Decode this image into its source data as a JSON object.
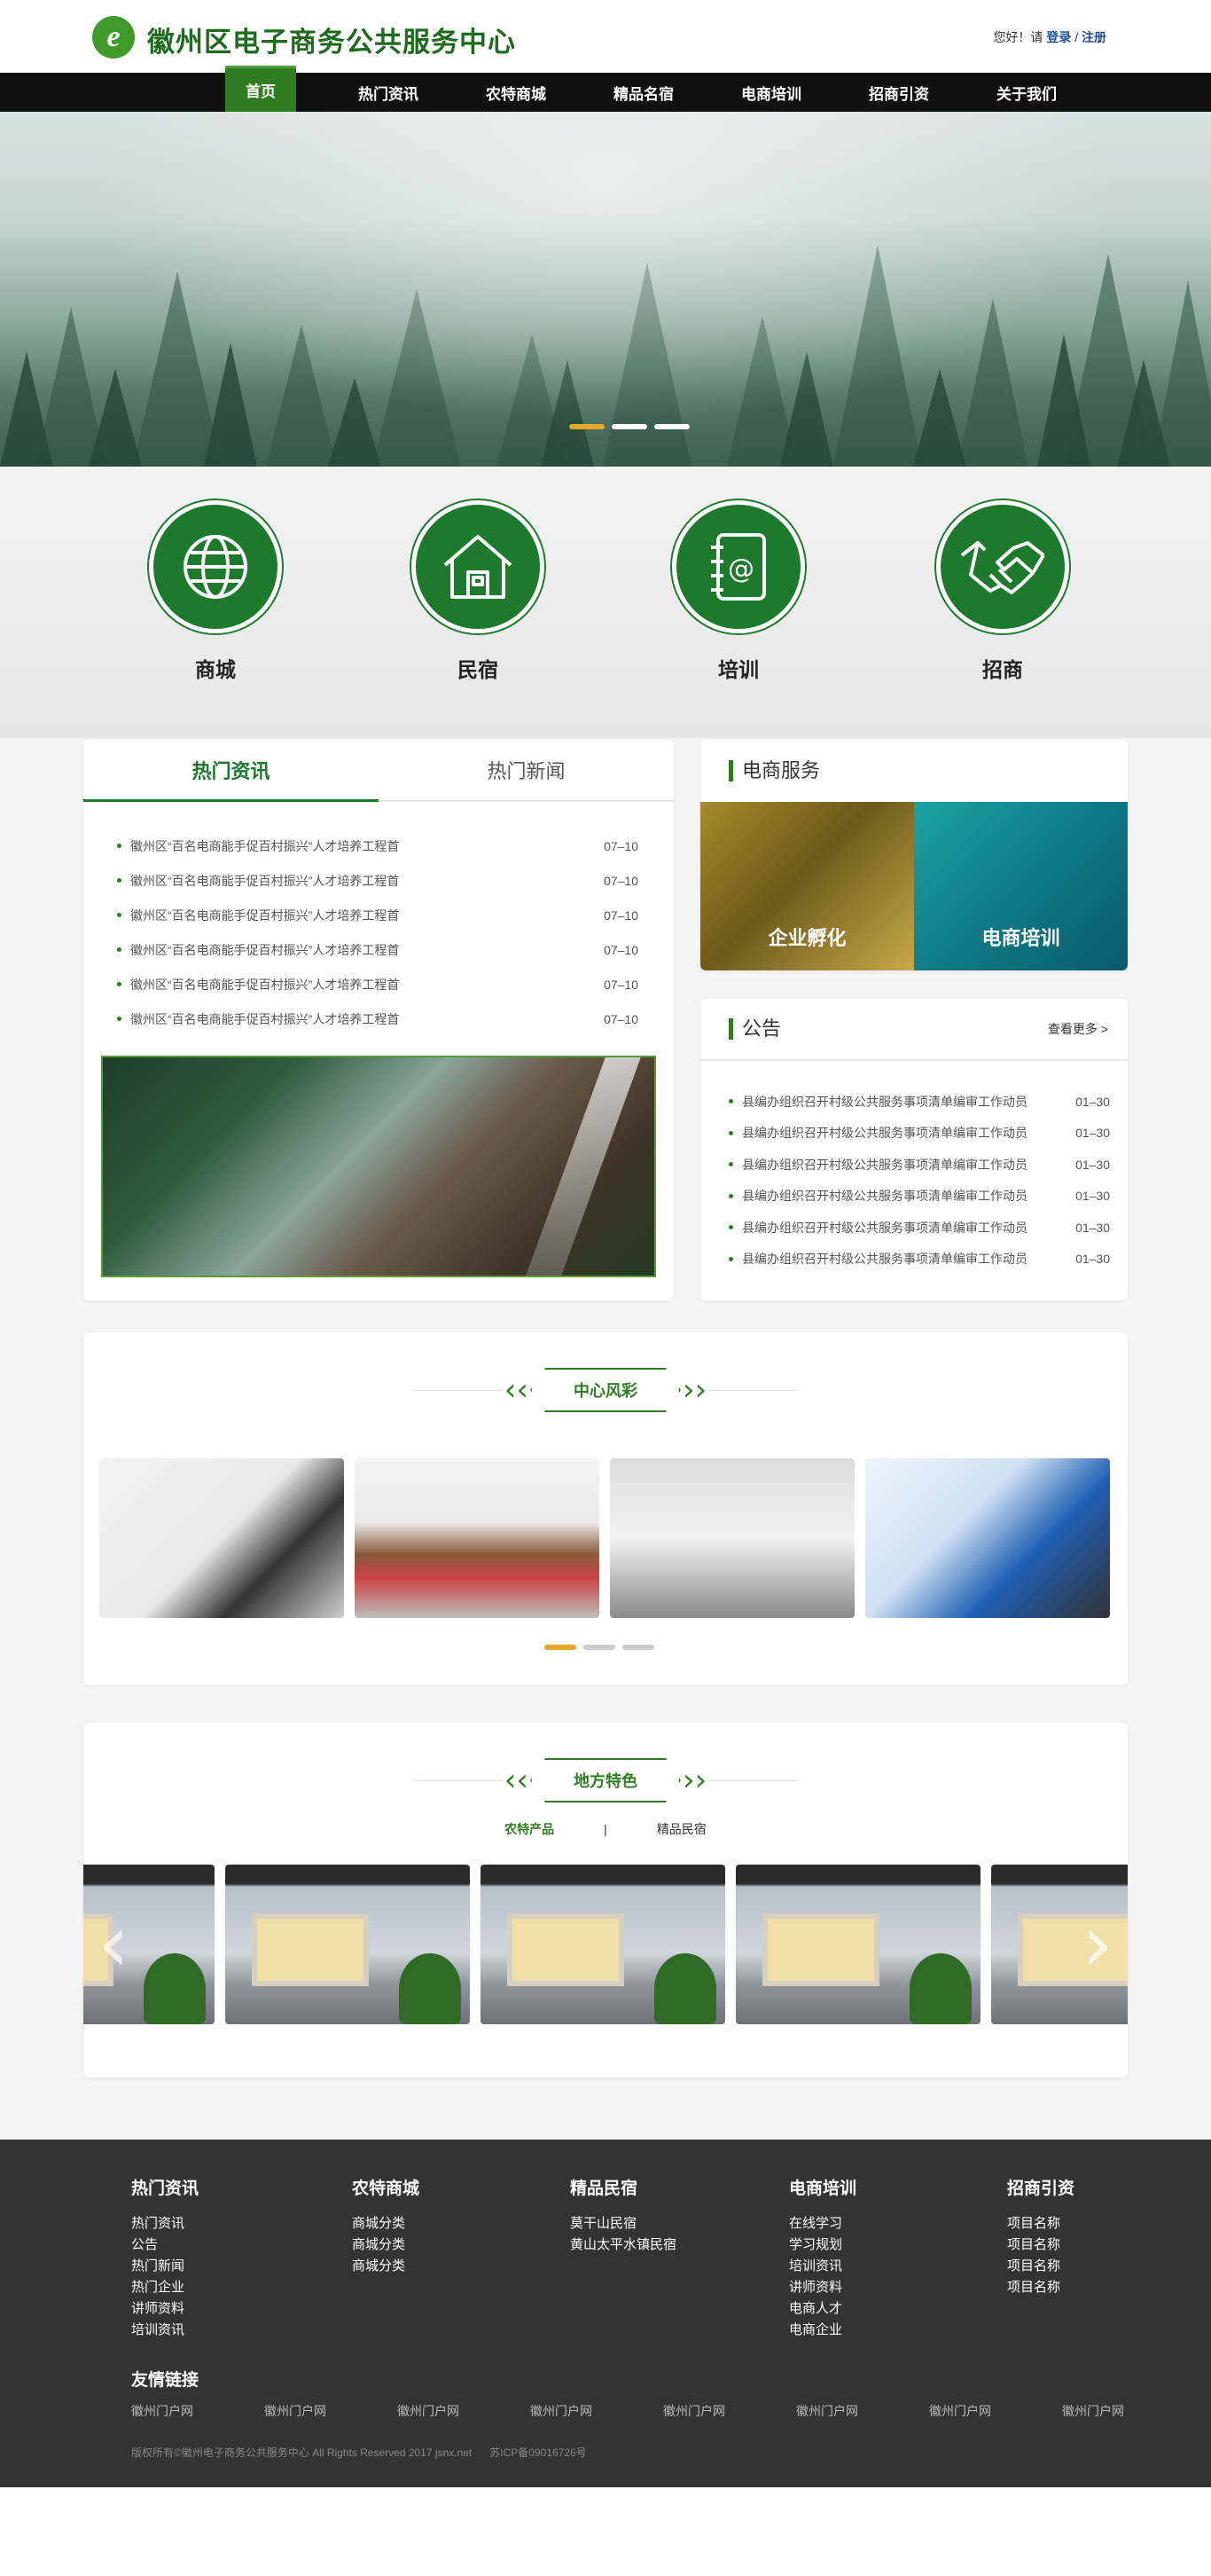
{
  "header": {
    "logo_letter": "e",
    "site_title": "徽州区电子商务公共服务中心",
    "greeting": "您好！请",
    "login": "登录",
    "separator": " / ",
    "register": "注册"
  },
  "nav": {
    "items": [
      {
        "label": "首页"
      },
      {
        "label": "热门资讯"
      },
      {
        "label": "农特商城"
      },
      {
        "label": "精品名宿"
      },
      {
        "label": "电商培训"
      },
      {
        "label": "招商引资"
      },
      {
        "label": "关于我们"
      }
    ],
    "active_index": 0
  },
  "banner": {
    "slide_count": 3,
    "active_slide": 0
  },
  "services": [
    {
      "label": "商城",
      "icon": "globe-icon"
    },
    {
      "label": "民宿",
      "icon": "house-icon"
    },
    {
      "label": "培训",
      "icon": "notebook-at-icon"
    },
    {
      "label": "招商",
      "icon": "handshake-icon"
    }
  ],
  "hot_news": {
    "tabs": [
      {
        "label": "热门资讯"
      },
      {
        "label": "热门新闻"
      }
    ],
    "items": [
      {
        "title": "徽州区“百名电商能手促百村振兴”人才培养工程首",
        "date": "07–10"
      },
      {
        "title": "徽州区“百名电商能手促百村振兴”人才培养工程首",
        "date": "07–10"
      },
      {
        "title": "徽州区“百名电商能手促百村振兴”人才培养工程首",
        "date": "07–10"
      },
      {
        "title": "徽州区“百名电商能手促百村振兴”人才培养工程首",
        "date": "07–10"
      },
      {
        "title": "徽州区“百名电商能手促百村振兴”人才培养工程首",
        "date": "07–10"
      },
      {
        "title": "徽州区“百名电商能手促百村振兴”人才培养工程首",
        "date": "07–10"
      }
    ]
  },
  "ecommerce_service": {
    "title": "电商服务",
    "items": [
      {
        "label": "企业孵化"
      },
      {
        "label": "电商培训"
      }
    ]
  },
  "notices": {
    "title": "公告",
    "more": "查看更多 >",
    "items": [
      {
        "title": "县编办组织召开村级公共服务事项清单编审工作动员",
        "date": "01–30"
      },
      {
        "title": "县编办组织召开村级公共服务事项清单编审工作动员",
        "date": "01–30"
      },
      {
        "title": "县编办组织召开村级公共服务事项清单编审工作动员",
        "date": "01–30"
      },
      {
        "title": "县编办组织召开村级公共服务事项清单编审工作动员",
        "date": "01–30"
      },
      {
        "title": "县编办组织召开村级公共服务事项清单编审工作动员",
        "date": "01–30"
      },
      {
        "title": "县编办组织召开村级公共服务事项清单编审工作动员",
        "date": "01–30"
      }
    ]
  },
  "center_style": {
    "title": "中心风彩",
    "photo_count": 4,
    "pager_count": 3,
    "active_page": 0
  },
  "local_features": {
    "title": "地方特色",
    "tabs": [
      {
        "label": "农特产品"
      },
      {
        "label": "精品民宿"
      }
    ],
    "separator": "|",
    "active_tab": 0
  },
  "footer": {
    "columns": [
      {
        "title": "热门资讯",
        "links": [
          "热门资讯",
          "公告",
          "热门新闻",
          "热门企业",
          "讲师资料",
          "培训资讯"
        ]
      },
      {
        "title": "农特商城",
        "links": [
          "商城分类",
          "商城分类",
          "商城分类"
        ]
      },
      {
        "title": "精品民宿",
        "links": [
          "莫干山民宿",
          "黄山太平水镇民宿"
        ]
      },
      {
        "title": "电商培训",
        "links": [
          "在线学习",
          "学习规划",
          "培训资讯",
          "讲师资料",
          "电商人才",
          "电商企业"
        ]
      },
      {
        "title": "招商引资",
        "links": [
          "项目名称",
          "项目名称",
          "项目名称",
          "项目名称"
        ]
      }
    ],
    "friend_links_title": "友情链接",
    "friend_links": [
      "徽州门户网",
      "徽州门户网",
      "徽州门户网",
      "徽州门户网",
      "徽州门户网",
      "徽州门户网",
      "徽州门户网",
      "徽州门户网"
    ],
    "copyright": "版权所有©徽州电子商务公共服务中心 All Rights Reserved 2017 jsnx.net",
    "icp": "苏ICP备09016726号"
  },
  "colors": {
    "brand_green": "#1d7a2d",
    "nav_bg": "#111111",
    "footer_bg": "#333333",
    "accent_orange": "#e8a52b"
  }
}
